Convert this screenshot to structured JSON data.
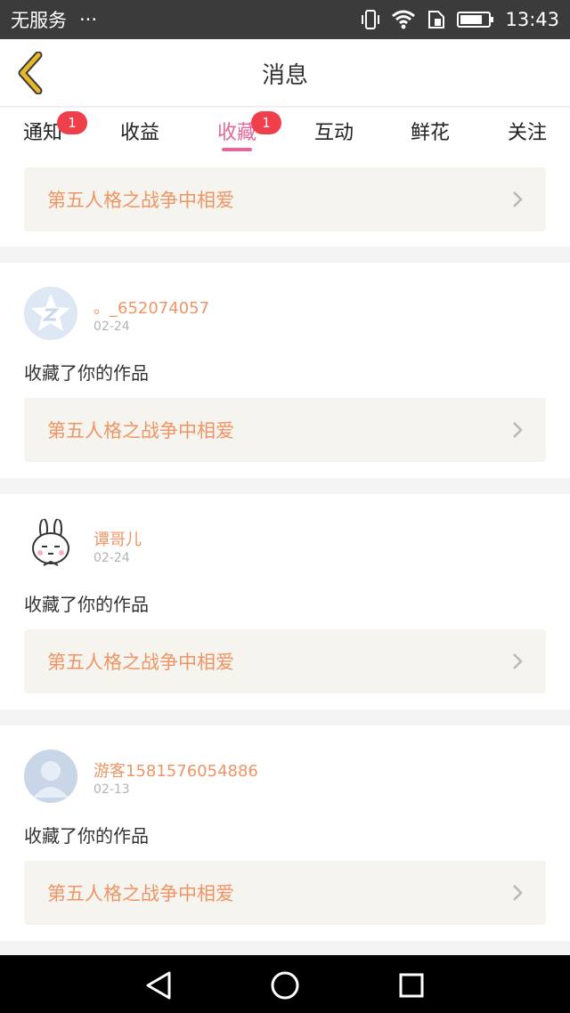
{
  "status_bar": {
    "carrier": "无服务",
    "more": "···",
    "time": "13:43",
    "icons": [
      "vibrate-icon",
      "wifi-icon",
      "sim-icon",
      "battery-icon"
    ]
  },
  "header": {
    "title": "消息",
    "back_icon": "chevron-left-icon"
  },
  "tabs": [
    {
      "label": "通知",
      "badge": "1",
      "active": false
    },
    {
      "label": "收益",
      "badge": "",
      "active": false
    },
    {
      "label": "收藏",
      "badge": "1",
      "active": true
    },
    {
      "label": "互动",
      "badge": "",
      "active": false
    },
    {
      "label": "鲜花",
      "badge": "",
      "active": false
    },
    {
      "label": "关注",
      "badge": "",
      "active": false
    }
  ],
  "top_work": {
    "title": "第五人格之战争中相爱"
  },
  "items": [
    {
      "username": "。_652074057",
      "date": "02-24",
      "action": "收藏了你的作品",
      "work_title": "第五人格之战争中相爱",
      "avatar": "qq-star-avatar"
    },
    {
      "username": "谭哥儿",
      "date": "02-24",
      "action": "收藏了你的作品",
      "work_title": "第五人格之战争中相爱",
      "avatar": "bunny-avatar"
    },
    {
      "username": "游客1581576054886",
      "date": "02-13",
      "action": "收藏了你的作品",
      "work_title": "第五人格之战争中相爱",
      "avatar": "default-avatar"
    }
  ],
  "colors": {
    "accent_pink": "#e4679a",
    "accent_orange": "#ef9565",
    "badge_red": "#ef3f4a",
    "back_chevron": "#e8b828"
  },
  "navbar": {
    "icons": [
      "back-triangle-icon",
      "home-circle-icon",
      "recents-square-icon"
    ]
  }
}
